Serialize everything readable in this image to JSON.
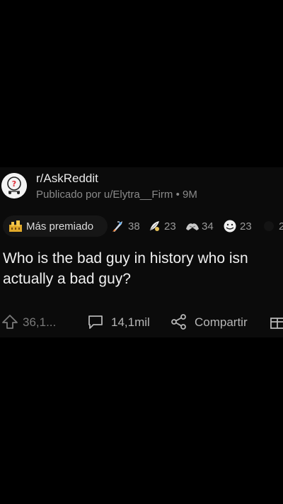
{
  "post": {
    "subreddit": "r/AskReddit",
    "byline": "Publicado por u/Elytra__Firm • 9M",
    "title_line1": "Who is the bad guy in history who isn",
    "title_line2": "actually a bad guy?"
  },
  "awards": {
    "top_label": "Más premiado",
    "items": [
      {
        "icon": "rocket-award-icon",
        "count": "38"
      },
      {
        "icon": "feather-award-icon",
        "count": "23"
      },
      {
        "icon": "hands-award-icon",
        "count": "34"
      },
      {
        "icon": "face-award-icon",
        "count": "23"
      },
      {
        "icon": "award-icon",
        "count": "2"
      }
    ]
  },
  "actions": {
    "upvotes": "36,1...",
    "comments": "14,1mil",
    "share": "Compartir"
  },
  "colors": {
    "background": "#000000",
    "card": "#0b0b0b",
    "text_primary": "#f0f0f0",
    "text_secondary": "#8a8a8a"
  }
}
